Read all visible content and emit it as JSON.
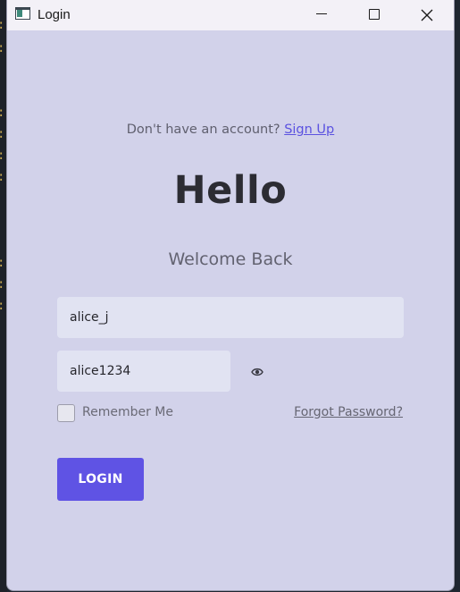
{
  "window": {
    "title": "Login"
  },
  "signup": {
    "prompt": "Don't have an account?",
    "link_label": "Sign Up"
  },
  "heading": {
    "title": "Hello",
    "subtitle": "Welcome Back"
  },
  "form": {
    "username_value": "alice_j",
    "password_value": "alice1234",
    "remember_label": "Remember Me",
    "remember_checked": false,
    "forgot_label": "Forgot Password?",
    "login_label": "LOGIN"
  },
  "icons": {
    "app": "window-app-icon",
    "minimize": "minimize-icon",
    "maximize": "maximize-icon",
    "close": "close-icon",
    "show_password": "eye-icon"
  },
  "colors": {
    "accent": "#5f53e4",
    "link": "#5b52e0",
    "background": "#d2d2ea",
    "field": "#e1e3f2"
  }
}
